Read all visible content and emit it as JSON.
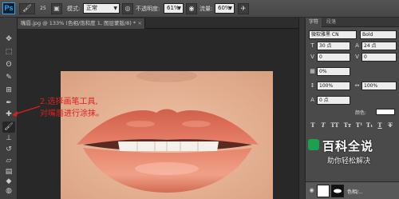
{
  "app": {
    "logo": "Ps"
  },
  "options_bar": {
    "brush_size": "25",
    "mode_label": "模式:",
    "mode_value": "正常",
    "opacity_label": "不透明度:",
    "opacity_value": "61%",
    "flow_label": "流量:",
    "flow_value": "60%",
    "icons": [
      "brush-tool-icon",
      "brush-panel-icon",
      "pressure-opacity-icon",
      "airbrush-icon",
      "pressure-size-icon"
    ]
  },
  "document": {
    "tab_title": "嘴唇.jpg @ 133% (色相/饱和度 1, 图层蒙版/8) *",
    "tab_close": "×"
  },
  "annotation": {
    "line1": "2.选择画笔工具,",
    "line2": "对嘴唇进行涂抹。",
    "color": "#d92020"
  },
  "toolbar": {
    "tools": [
      {
        "name": "move-tool",
        "glyph": "✥"
      },
      {
        "name": "marquee-tool",
        "glyph": "⬚"
      },
      {
        "name": "lasso-tool",
        "glyph": "ʘ"
      },
      {
        "name": "quick-select-tool",
        "glyph": "✎"
      },
      {
        "name": "crop-tool",
        "glyph": "⊞"
      },
      {
        "name": "eyedropper-tool",
        "glyph": "✒"
      },
      {
        "name": "healing-brush-tool",
        "glyph": "✚"
      },
      {
        "name": "brush-tool",
        "glyph": "🖌"
      },
      {
        "name": "clone-stamp-tool",
        "glyph": "⊥"
      },
      {
        "name": "history-brush-tool",
        "glyph": "↺"
      },
      {
        "name": "eraser-tool",
        "glyph": "▱"
      },
      {
        "name": "gradient-tool",
        "glyph": "▤"
      },
      {
        "name": "blur-tool",
        "glyph": "◆"
      },
      {
        "name": "dodge-tool",
        "glyph": "◍"
      },
      {
        "name": "pen-tool",
        "glyph": "✍"
      },
      {
        "name": "type-tool",
        "glyph": "T"
      }
    ]
  },
  "panel": {
    "tabs": [
      "字符",
      "段落"
    ],
    "font_family": "微软雅黑 CN",
    "font_style": "Bold",
    "font_size": "30 点",
    "leading": "24 点",
    "kerning": "0",
    "tracking": "0",
    "baseline": "0%",
    "vertical_scale": "100%",
    "horizontal_scale": "100%",
    "baseline_shift": "0 点",
    "color_label": "颜色:",
    "style_buttons": [
      "T",
      "T",
      "TT",
      "Tт",
      "T¹",
      "T₁",
      "T",
      "T"
    ],
    "layer_name": "色相/...",
    "text_color": "#ffffff"
  },
  "watermark": {
    "title": "百科全说",
    "subtitle": "助你轻松解决",
    "brand_color": "#1aa04f"
  }
}
